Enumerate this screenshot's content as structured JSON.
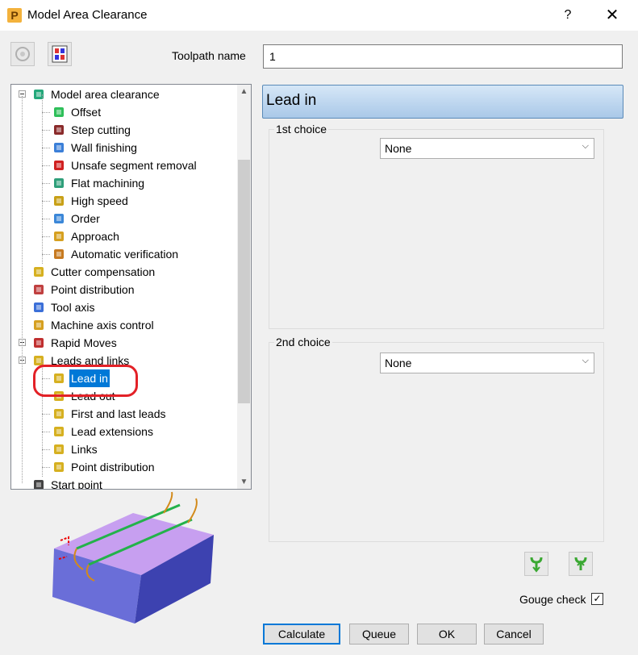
{
  "window": {
    "title": "Model Area Clearance",
    "help": "?",
    "close": "✕",
    "app_glyph": "P"
  },
  "toolpath": {
    "label": "Toolpath name",
    "value": "1"
  },
  "tree": {
    "items": [
      {
        "label": "Model area clearance",
        "icon": "model-area-clearance-icon"
      },
      {
        "label": "Offset",
        "icon": "offset-icon"
      },
      {
        "label": "Step cutting",
        "icon": "step-cutting-icon"
      },
      {
        "label": "Wall finishing",
        "icon": "wall-finishing-icon"
      },
      {
        "label": "Unsafe segment removal",
        "icon": "unsafe-segment-icon"
      },
      {
        "label": "Flat machining",
        "icon": "flat-machining-icon"
      },
      {
        "label": "High speed",
        "icon": "high-speed-icon"
      },
      {
        "label": "Order",
        "icon": "order-icon"
      },
      {
        "label": "Approach",
        "icon": "approach-icon"
      },
      {
        "label": "Automatic verification",
        "icon": "verification-icon"
      },
      {
        "label": "Cutter compensation",
        "icon": "cutter-compensation-icon"
      },
      {
        "label": "Point distribution",
        "icon": "point-distribution-icon"
      },
      {
        "label": "Tool axis",
        "icon": "tool-axis-icon"
      },
      {
        "label": "Machine axis control",
        "icon": "machine-axis-icon"
      },
      {
        "label": "Rapid Moves",
        "icon": "rapid-moves-icon"
      },
      {
        "label": "Leads and links",
        "icon": "leads-links-icon"
      },
      {
        "label": "Lead in",
        "icon": "lead-in-icon"
      },
      {
        "label": "Lead out",
        "icon": "lead-out-icon"
      },
      {
        "label": "First and last leads",
        "icon": "first-last-leads-icon"
      },
      {
        "label": "Lead extensions",
        "icon": "lead-extensions-icon"
      },
      {
        "label": "Links",
        "icon": "links-icon"
      },
      {
        "label": "Point distribution",
        "icon": "point-distribution-icon"
      },
      {
        "label": "Start point",
        "icon": "start-point-icon"
      }
    ],
    "selected": "Lead in"
  },
  "panel": {
    "title": "Lead in",
    "first": {
      "legend": "1st choice",
      "value": "None"
    },
    "second": {
      "legend": "2nd choice",
      "value": "None"
    }
  },
  "gouge": {
    "label": "Gouge check",
    "checked": true,
    "mark": "✓"
  },
  "buttons": {
    "calculate": "Calculate",
    "queue": "Queue",
    "ok": "OK",
    "cancel": "Cancel"
  },
  "colors": {
    "accent": "#0078d7",
    "highlight": "#e32127",
    "block_top": "#c79ff0",
    "block_side": "#6a6ed8"
  }
}
